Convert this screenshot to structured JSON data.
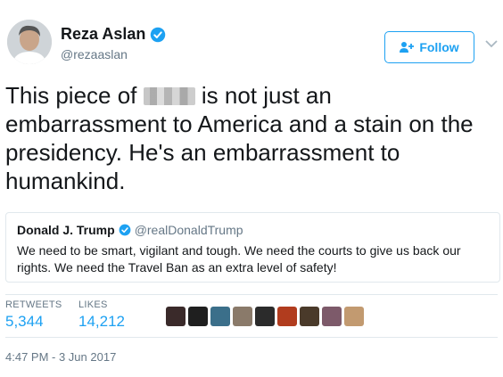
{
  "author": {
    "name": "Reza Aslan",
    "handle": "@rezaaslan",
    "avatar_icon": "person-photo-avatar",
    "verified_icon": "verified-badge-icon"
  },
  "follow_button": {
    "label": "Follow",
    "icon": "add-person-icon",
    "color": "#1da1f2"
  },
  "tweet": {
    "text_before": "This piece of",
    "redacted_word_icon": "pixelated-blur",
    "text_after": " is not just an embarrassment to America and a stain on the presidency. He's an embarrassment to humankind."
  },
  "quoted_tweet": {
    "name": "Donald J. Trump",
    "handle": "@realDonaldTrump",
    "text": "We need to be smart, vigilant and tough. We need the courts to give us back our rights. We need the Travel Ban as an extra level of safety!"
  },
  "stats": {
    "retweets_label": "RETWEETS",
    "retweets_value": "5,344",
    "likes_label": "LIKES",
    "likes_value": "14,212"
  },
  "likers": [
    "#3a2a2a",
    "#1f1f1f",
    "#3b6f8a",
    "#8a7a6a",
    "#2b2b2b",
    "#b13c1e",
    "#4a3a2a",
    "#7d5a6a",
    "#c29a70"
  ],
  "timestamp": "4:47 PM - 3 Jun 2017",
  "colors": {
    "accent": "#1da1f2",
    "muted": "#657786",
    "border": "#e1e8ed"
  }
}
